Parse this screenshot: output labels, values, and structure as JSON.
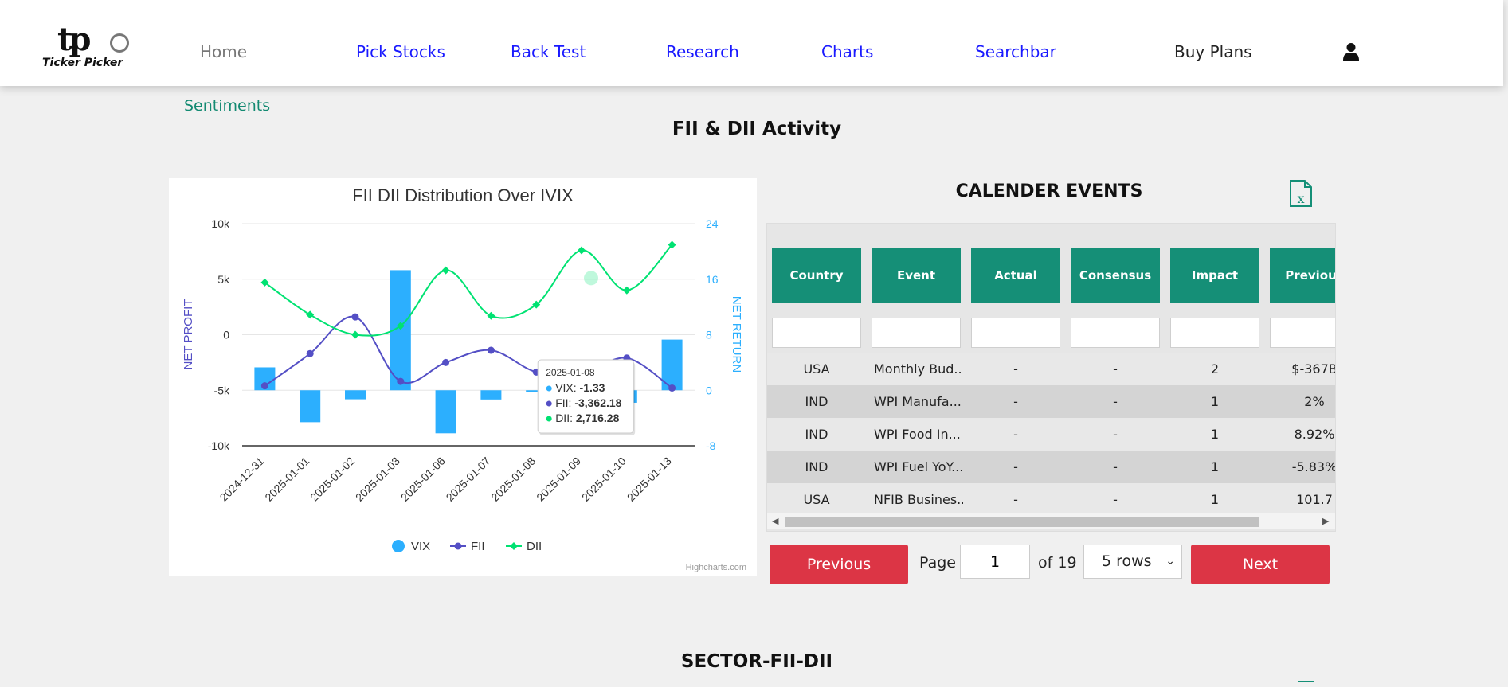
{
  "nav": {
    "logo_text": "Ticker Picker",
    "logo_mark": "tp",
    "items": [
      {
        "label": "Home"
      },
      {
        "label": "Pick Stocks"
      },
      {
        "label": "Back Test"
      },
      {
        "label": "Research"
      },
      {
        "label": "Charts"
      },
      {
        "label": "Searchbar"
      },
      {
        "label": "Buy Plans"
      }
    ],
    "user_icon": "user-icon"
  },
  "breadcrumb": "Sentiments",
  "page_title": "FII & DII Activity",
  "section2_title": "SECTOR-FII-DII",
  "chart_data": {
    "type": "bar+line",
    "title": "FII DII Distribution Over IVIX",
    "categories": [
      "2024-12-31",
      "2025-01-01",
      "2025-01-02",
      "2025-01-03",
      "2025-01-06",
      "2025-01-07",
      "2025-01-08",
      "2025-01-09",
      "2025-01-10",
      "2025-01-13"
    ],
    "y_left": {
      "label": "NET PROFIT",
      "ticks": [
        "10k",
        "5k",
        "0",
        "-5k",
        "-10k"
      ],
      "ylim": [
        -10000,
        10000
      ]
    },
    "y_right": {
      "label": "NET RETURN",
      "ticks": [
        "24",
        "16",
        "8",
        "0",
        "-8"
      ],
      "ylim": [
        -8,
        24
      ]
    },
    "series": [
      {
        "name": "VIX",
        "type": "bar",
        "axis": "right",
        "color": "#2caffe",
        "values": [
          3.3,
          -4.6,
          -1.3,
          17.3,
          -6.2,
          -1.33,
          -0.2,
          -1.1,
          -1.8,
          7.3
        ]
      },
      {
        "name": "FII",
        "type": "line",
        "axis": "left",
        "color": "#544fc5",
        "values": [
          -4600,
          -1700,
          1600,
          -4200,
          -2500,
          -1400,
          -3362.18,
          -3500,
          -2100,
          -4800
        ]
      },
      {
        "name": "DII",
        "type": "line",
        "axis": "left",
        "color": "#00e272",
        "values": [
          4700,
          1800,
          0,
          800,
          5800,
          1700,
          2716.28,
          7600,
          4000,
          8100
        ]
      }
    ],
    "tooltip": {
      "date": "2025-01-08",
      "lines": [
        {
          "name": "VIX",
          "value": "-1.33",
          "color": "#2caffe"
        },
        {
          "name": "FII",
          "value": "-3,362.18",
          "color": "#544fc5"
        },
        {
          "name": "DII",
          "value": "2,716.28",
          "color": "#00e272"
        }
      ]
    },
    "legend": [
      "VIX",
      "FII",
      "DII"
    ],
    "legend_position": "bottom",
    "credits": "Highcharts.com"
  },
  "calendar": {
    "title": "CALENDER EVENTS",
    "export_icon": "excel-icon",
    "columns": [
      "Country",
      "Event",
      "Actual",
      "Consensus",
      "Impact",
      "Previous"
    ],
    "rows": [
      [
        "USA",
        "Monthly Bud...",
        "-",
        "-",
        "2",
        "$-367B"
      ],
      [
        "IND",
        "WPI Manufa...",
        "-",
        "-",
        "1",
        "2%"
      ],
      [
        "IND",
        "WPI Food In...",
        "-",
        "-",
        "1",
        "8.92%"
      ],
      [
        "IND",
        "WPI Fuel YoY...",
        "-",
        "-",
        "1",
        "-5.83%"
      ],
      [
        "USA",
        "NFIB Busines...",
        "-",
        "-",
        "1",
        "101.7"
      ]
    ],
    "pagination": {
      "previous_label": "Previous",
      "next_label": "Next",
      "page_label": "Page",
      "current_page": "1",
      "of_label": "of 19",
      "rows_label": "5 rows"
    }
  }
}
